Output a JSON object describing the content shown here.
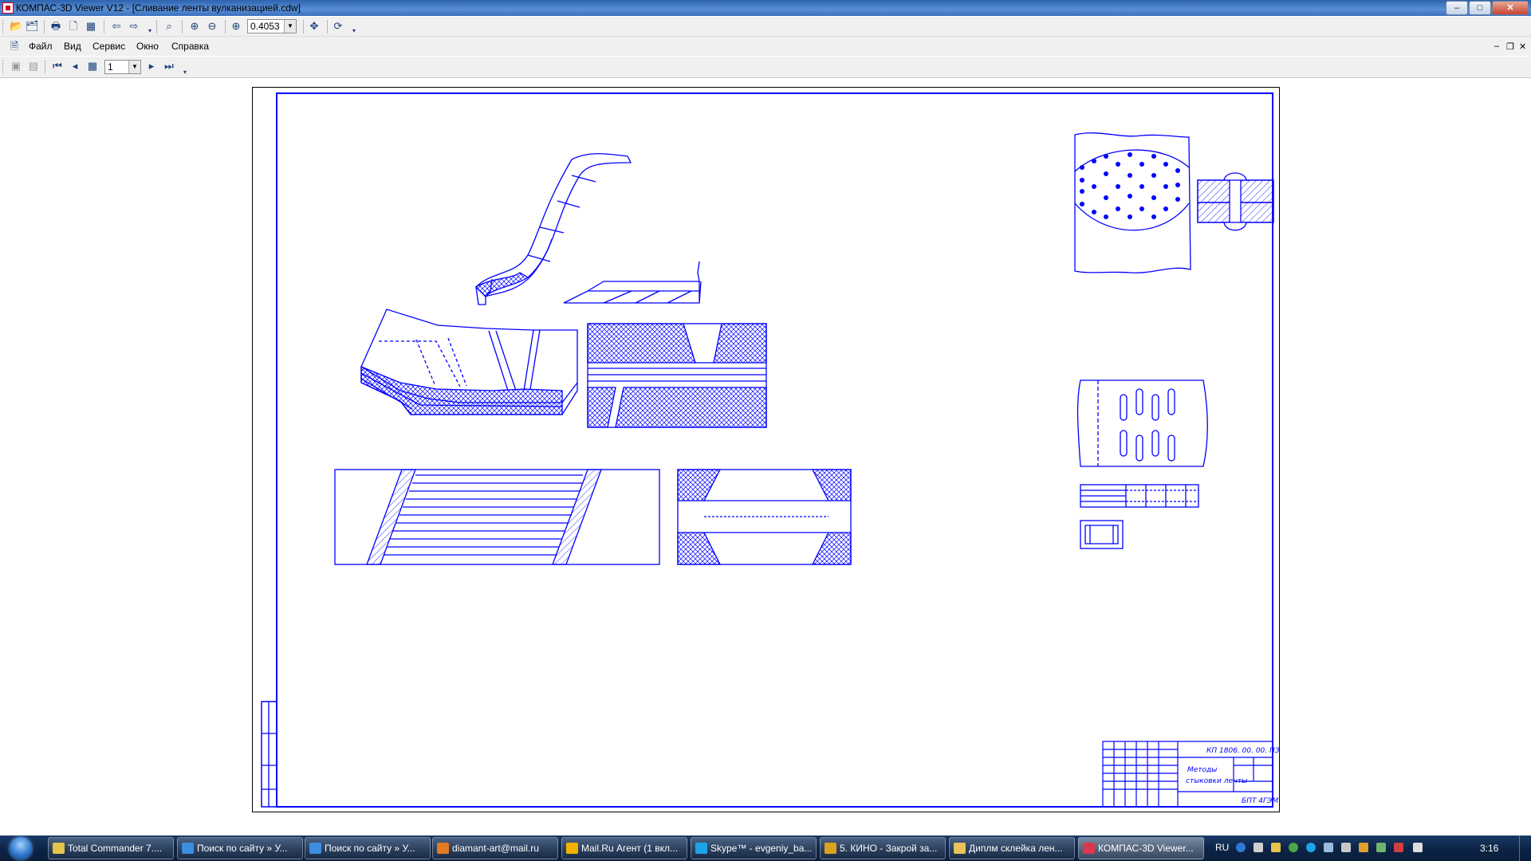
{
  "window": {
    "title": "КОМПАС-3D Viewer V12 - [Сливание ленты вулканизацией.cdw]",
    "min_label": "–",
    "max_label": "□",
    "close_label": "✕"
  },
  "toolbar": {
    "zoom_value": "0.4053",
    "page_value": "1"
  },
  "menu": {
    "file": "Файл",
    "view": "Вид",
    "service": "Сервис",
    "window": "Окно",
    "help": "Справка"
  },
  "mdi": {
    "min_label": "–",
    "restore_label": "❐",
    "close_label": "✕"
  },
  "drawing": {
    "designation": "КП 1806. 00. 00. ПЗ",
    "title_line1": "Методы",
    "title_line2": "стыковки ленты",
    "organization": "БПТ 4ГЭМ",
    "line_color": "#0000ff"
  },
  "taskbar": {
    "items": [
      {
        "label": "Total Commander 7....",
        "icon": "total-commander-icon",
        "color": "#e6c34a"
      },
      {
        "label": "Поиск по сайту » У...",
        "icon": "ie-icon",
        "color": "#3b8ee0"
      },
      {
        "label": "Поиск по сайту » У...",
        "icon": "ie-icon",
        "color": "#3b8ee0"
      },
      {
        "label": "diamant-art@mail.ru",
        "icon": "firefox-icon",
        "color": "#e27b22"
      },
      {
        "label": "Mail.Ru Агент (1 вкл...",
        "icon": "mail-agent-icon",
        "color": "#f2b100"
      },
      {
        "label": "Skype™ - evgeniy_ba...",
        "icon": "skype-icon",
        "color": "#1fa3e8"
      },
      {
        "label": "5. КИНО - Закрой за...",
        "icon": "winamp-icon",
        "color": "#d9a21f"
      },
      {
        "label": "Диплм склейка лен...",
        "icon": "folder-icon",
        "color": "#e8c35a"
      },
      {
        "label": "КОМПАС-3D Viewer...",
        "icon": "kompas-icon",
        "color": "#d8384f"
      }
    ],
    "lang": "RU",
    "clock": "3:16"
  }
}
